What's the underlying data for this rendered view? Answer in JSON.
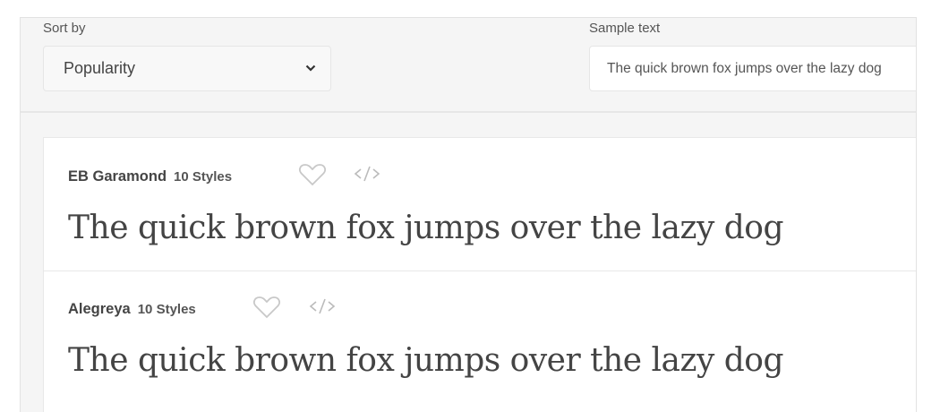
{
  "controls": {
    "sort_label": "Sort by",
    "sort_value": "Popularity",
    "sample_label": "Sample text",
    "sample_value": "The quick brown fox jumps over the lazy dog"
  },
  "fonts": [
    {
      "name": "EB Garamond",
      "styles": "10 Styles",
      "sample": "The quick brown fox jumps over the lazy dog"
    },
    {
      "name": "Alegreya",
      "styles": "10 Styles",
      "sample": "The quick brown fox jumps over the lazy dog"
    }
  ]
}
